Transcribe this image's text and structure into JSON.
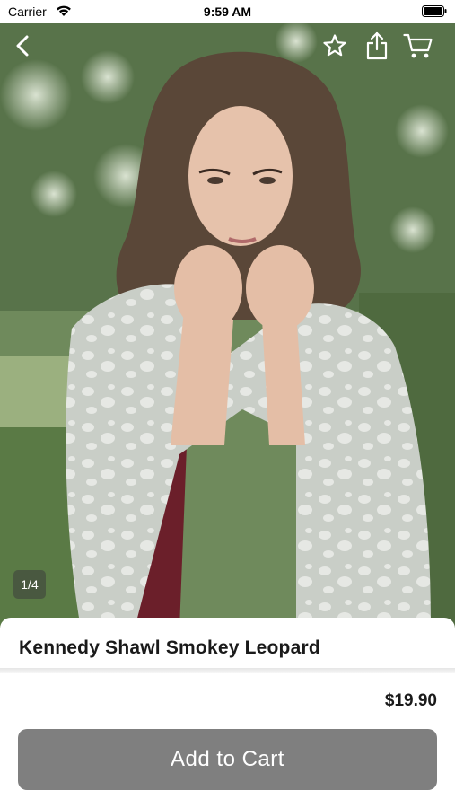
{
  "status_bar": {
    "carrier": "Carrier",
    "time": "9:59 AM",
    "wifi_icon": "wifi-icon",
    "battery_icon": "battery-icon"
  },
  "nav": {
    "back_icon": "chevron-left-icon",
    "favorite_icon": "star-icon",
    "share_icon": "share-icon",
    "cart_icon": "cart-icon"
  },
  "gallery": {
    "page_indicator": "1/4",
    "current_page": 1,
    "total_pages": 4
  },
  "product": {
    "title": "Kennedy Shawl Smokey Leopard",
    "price": "$19.90"
  },
  "actions": {
    "add_to_cart_label": "Add to Cart"
  },
  "colors": {
    "button_background": "#7f7f7f",
    "button_text": "#ffffff",
    "text_primary": "#1a1a1a"
  }
}
